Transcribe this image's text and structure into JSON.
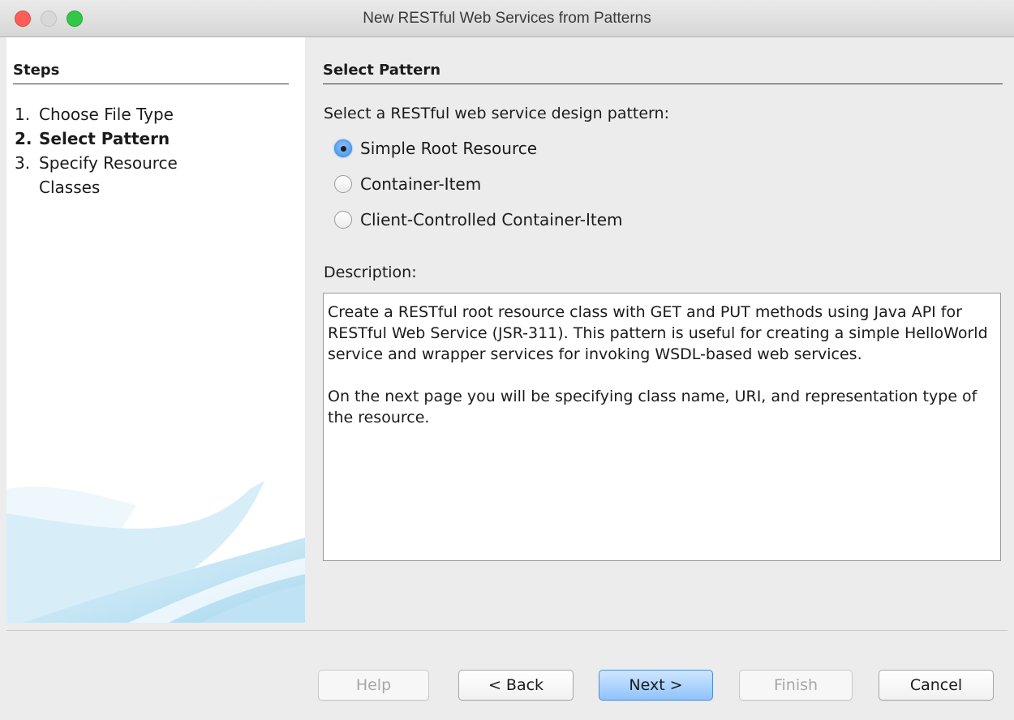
{
  "window": {
    "title": "New RESTful Web Services from Patterns"
  },
  "steps": {
    "heading": "Steps",
    "items": [
      {
        "number": "1.",
        "label": "Choose File Type",
        "current": false
      },
      {
        "number": "2.",
        "label": "Select Pattern",
        "current": true
      },
      {
        "number": "3.",
        "label": "Specify Resource Classes",
        "current": false
      }
    ]
  },
  "panel": {
    "heading": "Select Pattern",
    "prompt": "Select a RESTful web service design pattern:",
    "options": [
      {
        "label": "Simple Root Resource",
        "selected": true
      },
      {
        "label": "Container-Item",
        "selected": false
      },
      {
        "label": "Client-Controlled Container-Item",
        "selected": false
      }
    ],
    "description_label": "Description:",
    "description": [
      "Create a RESTful root resource class with GET and PUT methods using Java API for RESTful Web Service (JSR-311). This pattern is useful for creating a simple HelloWorld service and wrapper services for invoking WSDL-based web services.",
      "On the next page you will be specifying class name, URI, and representation type of the resource."
    ]
  },
  "buttons": {
    "help": "Help",
    "back": "< Back",
    "next": "Next >",
    "finish": "Finish",
    "cancel": "Cancel"
  }
}
